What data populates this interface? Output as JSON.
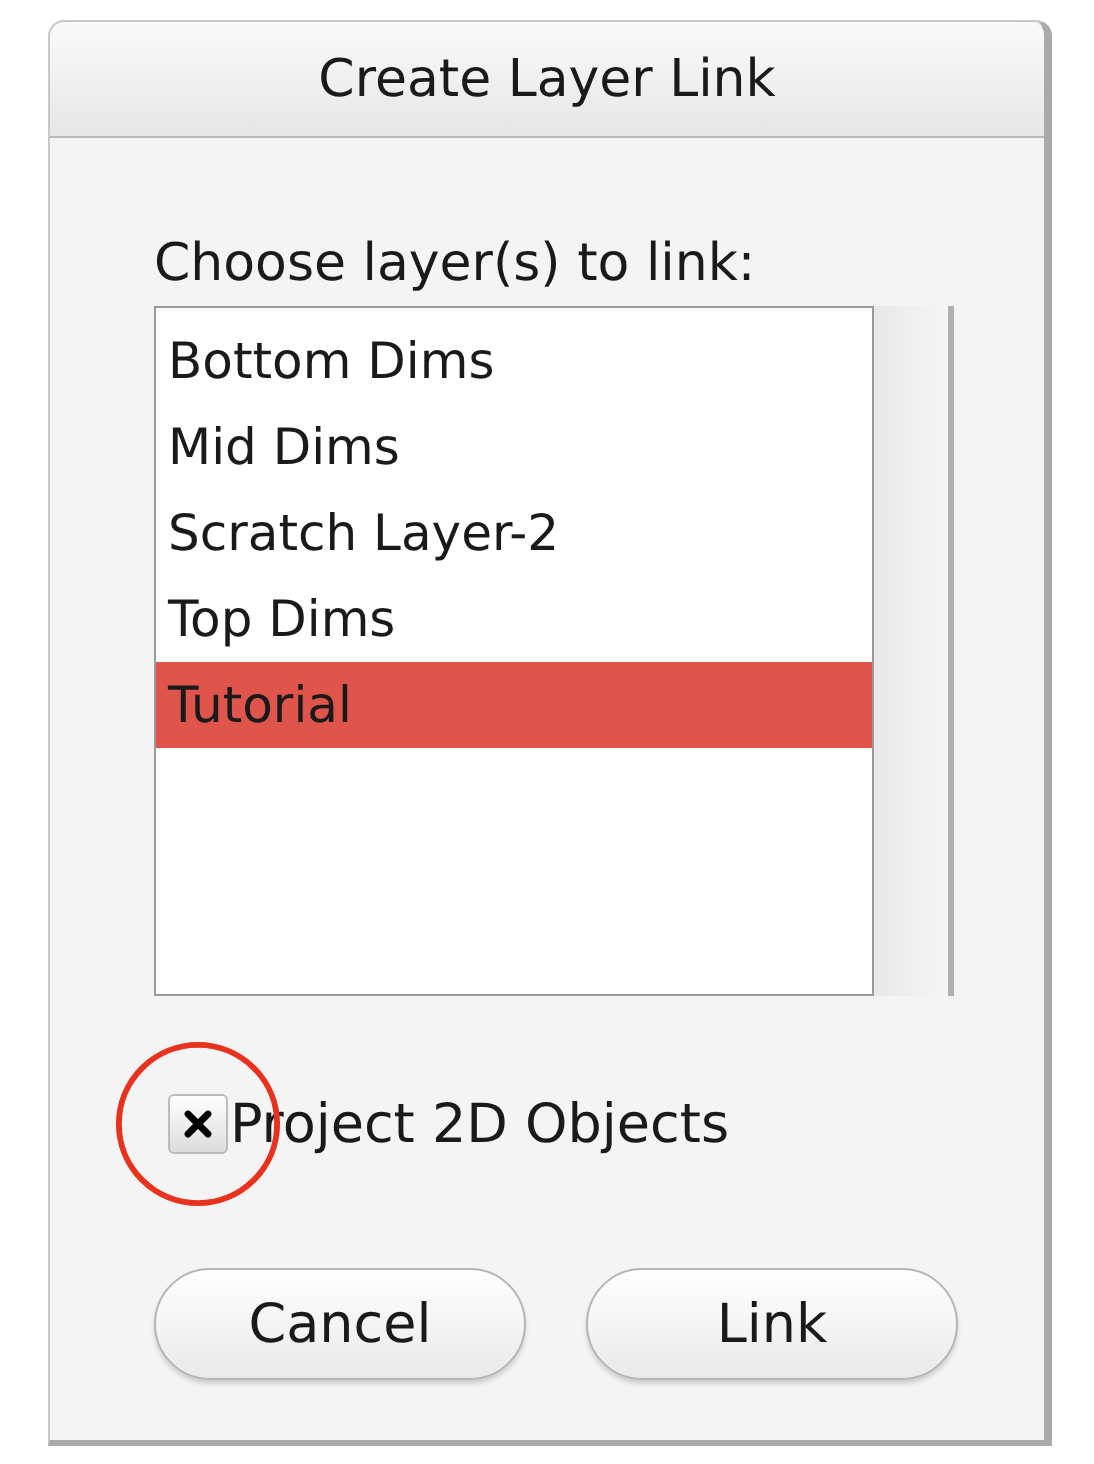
{
  "window": {
    "title": "Create Layer Link"
  },
  "prompt": "Choose layer(s) to link:",
  "layers": [
    {
      "name": "Bottom Dims",
      "selected": false
    },
    {
      "name": "Mid Dims",
      "selected": false
    },
    {
      "name": "Scratch Layer-2",
      "selected": false
    },
    {
      "name": "Top Dims",
      "selected": false
    },
    {
      "name": "Tutorial",
      "selected": true
    }
  ],
  "option": {
    "label": "Project 2D Objects",
    "checked": true
  },
  "buttons": [
    "Cancel",
    "Link"
  ]
}
